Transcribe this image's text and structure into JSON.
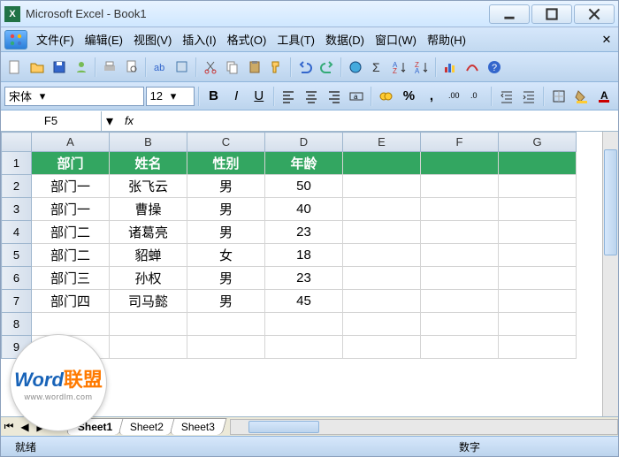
{
  "title": "Microsoft Excel - Book1",
  "menu": [
    "文件(F)",
    "编辑(E)",
    "视图(V)",
    "插入(I)",
    "格式(O)",
    "工具(T)",
    "数据(D)",
    "窗口(W)",
    "帮助(H)"
  ],
  "font": {
    "name": "宋体",
    "size": "12"
  },
  "namebox": "F5",
  "columns": [
    "A",
    "B",
    "C",
    "D",
    "E",
    "F",
    "G"
  ],
  "headers": [
    "部门",
    "姓名",
    "性别",
    "年龄"
  ],
  "rows": [
    [
      "部门一",
      "张飞云",
      "男",
      "50"
    ],
    [
      "部门一",
      "曹操",
      "男",
      "40"
    ],
    [
      "部门二",
      "诸葛亮",
      "男",
      "23"
    ],
    [
      "部门二",
      "貂蝉",
      "女",
      "18"
    ],
    [
      "部门三",
      "孙权",
      "男",
      "23"
    ],
    [
      "部门四",
      "司马懿",
      "男",
      "45"
    ]
  ],
  "sheets": [
    "Sheet1",
    "Sheet2",
    "Sheet3"
  ],
  "status": {
    "ready": "就绪",
    "mode": "数字"
  },
  "watermark": {
    "brand1": "Word",
    "brand2": "联盟",
    "url": "www.wordlm.com"
  }
}
